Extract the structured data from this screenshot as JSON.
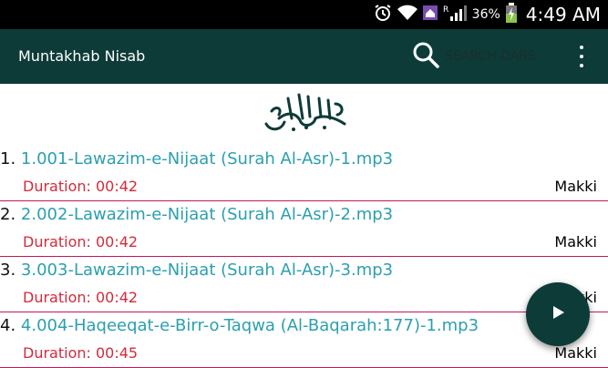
{
  "status_bar": {
    "battery_percent": "36%",
    "time": "4:49 AM",
    "icons": [
      "alarm-icon",
      "wifi-icon",
      "home-icon",
      "roaming-icon",
      "signal-icon",
      "battery-charging-icon"
    ]
  },
  "app_bar": {
    "title": "Muntakhab Nisab",
    "search_placeholder": "SEARCH DARS",
    "search_icon": "search-icon",
    "overflow_icon": "overflow-menu-icon"
  },
  "header_logo": "bismillah-calligraphy",
  "tracks": [
    {
      "number": "1.",
      "title": "1.001-Lawazim-e-Nijaat (Surah Al-Asr)-1.mp3",
      "duration": "Duration: 00:42",
      "type": "Makki"
    },
    {
      "number": "2.",
      "title": "2.002-Lawazim-e-Nijaat (Surah Al-Asr)-2.mp3",
      "duration": "Duration: 00:42",
      "type": "Makki"
    },
    {
      "number": "3.",
      "title": "3.003-Lawazim-e-Nijaat (Surah Al-Asr)-3.mp3",
      "duration": "Duration: 00:42",
      "type": "Makki"
    },
    {
      "number": "4.",
      "title": "4.004-Haqeeqat-e-Birr-o-Taqwa (Al-Baqarah:177)-1.mp3",
      "duration": "Duration: 00:45",
      "type": "Makki"
    }
  ],
  "fab_icon": "play-icon",
  "colors": {
    "app_bar": "#0d3b38",
    "track_title": "#2b9fb0",
    "duration": "#d22b3c",
    "divider": "#c2185b"
  }
}
